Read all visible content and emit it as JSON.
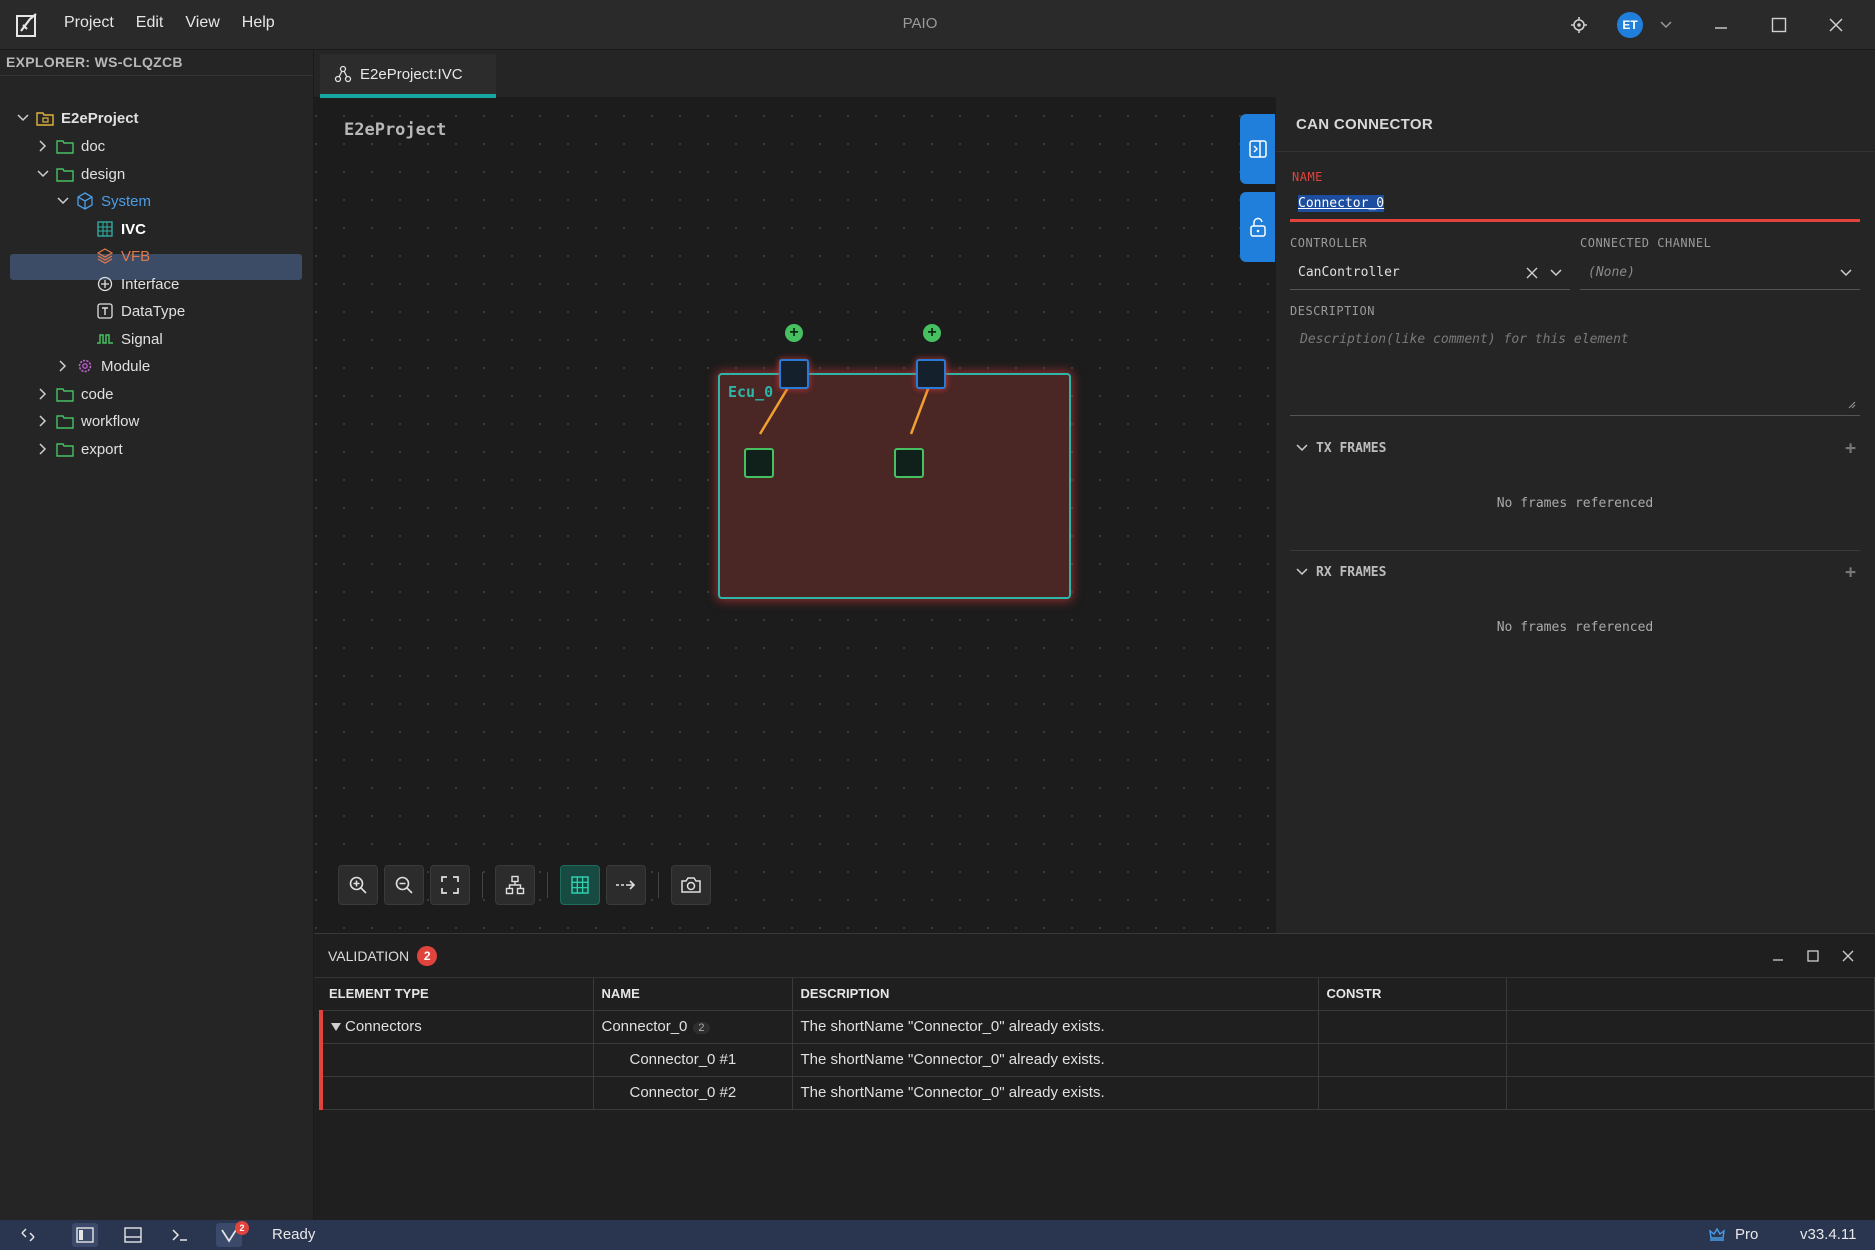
{
  "app": {
    "title": "PAIO",
    "menu": [
      "Project",
      "Edit",
      "View",
      "Help"
    ],
    "user_initials": "ET"
  },
  "explorer": {
    "header": "EXPLORER: WS-CLQZCB",
    "items": [
      {
        "label": "E2eProject",
        "icon": "project-icon",
        "expanded": true
      },
      {
        "label": "doc",
        "icon": "folder-icon",
        "expanded": false
      },
      {
        "label": "design",
        "icon": "folder-icon",
        "expanded": true
      },
      {
        "label": "System",
        "icon": "cube-icon",
        "expanded": true
      },
      {
        "label": "IVC",
        "icon": "grid-icon",
        "selected": true
      },
      {
        "label": "VFB",
        "icon": "layers-icon"
      },
      {
        "label": "Interface",
        "icon": "interface-icon"
      },
      {
        "label": "DataType",
        "icon": "datatype-icon"
      },
      {
        "label": "Signal",
        "icon": "signal-icon"
      },
      {
        "label": "Module",
        "icon": "gear-icon",
        "expanded": false
      },
      {
        "label": "code",
        "icon": "folder-icon",
        "expanded": false
      },
      {
        "label": "workflow",
        "icon": "folder-icon",
        "expanded": false
      },
      {
        "label": "export",
        "icon": "folder-icon",
        "expanded": false
      }
    ]
  },
  "editor": {
    "tab_label": "E2eProject:IVC",
    "canvas_title": "E2eProject",
    "ecu_label": "Ecu_0"
  },
  "properties": {
    "header": "CAN CONNECTOR",
    "name_label": "NAME",
    "name_value": "Connector_0",
    "controller_label": "CONTROLLER",
    "controller_value": "CanController",
    "channel_label": "CONNECTED CHANNEL",
    "channel_value": "(None)",
    "description_label": "DESCRIPTION",
    "description_placeholder": "Description(like comment) for this element",
    "tx_label": "TX FRAMES",
    "tx_empty": "No frames referenced",
    "rx_label": "RX FRAMES",
    "rx_empty": "No frames referenced"
  },
  "validation": {
    "title": "VALIDATION",
    "count": "2",
    "columns": [
      "ELEMENT TYPE",
      "NAME",
      "DESCRIPTION",
      "CONSTR",
      ""
    ],
    "rows": [
      {
        "type": "Connectors",
        "name": "Connector_0",
        "badge": "2",
        "description": "The shortName \"Connector_0\" already exists."
      },
      {
        "type": "",
        "name": "Connector_0 #1",
        "description": "The shortName \"Connector_0\" already exists."
      },
      {
        "type": "",
        "name": "Connector_0 #2",
        "description": "The shortName \"Connector_0\" already exists."
      }
    ]
  },
  "statusbar": {
    "status": "Ready",
    "badge": "2",
    "plan": "Pro",
    "version": "v33.4.11"
  },
  "colors": {
    "accent_blue": "#1f7fdb",
    "teal": "#2fb5a8",
    "error_red": "#e0443c",
    "port_green": "#47c062",
    "wire_orange": "#f0a030"
  }
}
